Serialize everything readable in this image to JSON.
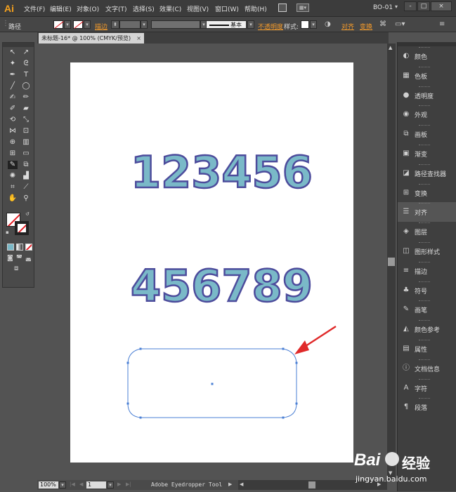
{
  "app": {
    "logo": "Ai",
    "workspace": "BO-01"
  },
  "menu": [
    "文件(F)",
    "编辑(E)",
    "对象(O)",
    "文字(T)",
    "选择(S)",
    "效果(C)",
    "视图(V)",
    "窗口(W)",
    "帮助(H)"
  ],
  "window_buttons": [
    "-",
    "□",
    "×"
  ],
  "control_bar": {
    "label": "路径",
    "stroke_label": "描边",
    "stroke_profile": "基本",
    "opacity_label": "不透明度",
    "style_label": "样式:",
    "align_label": "对齐",
    "transform_label": "变换"
  },
  "document_tab": {
    "title": "未标题-16* @ 100% (CMYK/预览)",
    "close": "×"
  },
  "artboard": {
    "line1": "123456",
    "line2": "456789"
  },
  "colors": {
    "fill": "#7ab9c8",
    "stroke": "#4d4c9c",
    "selection": "#4a7fd4",
    "arrow": "#e02a2a"
  },
  "status": {
    "zoom": "100%",
    "page": "1",
    "tool": "Adobe Eyedropper Tool"
  },
  "panels": [
    {
      "icon": "palette-icon",
      "glyph": "◐",
      "label": "颜色"
    },
    {
      "icon": "swatches-icon",
      "glyph": "▦",
      "label": "色板"
    },
    {
      "icon": "transparency-icon",
      "glyph": "●",
      "label": "透明度"
    },
    {
      "icon": "appearance-icon",
      "glyph": "◉",
      "label": "外观"
    },
    {
      "icon": "artboards-icon",
      "glyph": "⧉",
      "label": "画板"
    },
    {
      "icon": "gradient-icon",
      "glyph": "▣",
      "label": "渐变"
    },
    {
      "icon": "pathfinder-icon",
      "glyph": "◪",
      "label": "路径查找器"
    },
    {
      "icon": "transform-icon",
      "glyph": "⊞",
      "label": "变换"
    },
    {
      "icon": "align-icon",
      "glyph": "☰",
      "label": "对齐"
    },
    {
      "icon": "layers-icon",
      "glyph": "◈",
      "label": "图层"
    },
    {
      "icon": "graphic-styles-icon",
      "glyph": "◫",
      "label": "图形样式"
    },
    {
      "icon": "stroke-icon",
      "glyph": "≡",
      "label": "描边"
    },
    {
      "icon": "symbols-icon",
      "glyph": "♣",
      "label": "符号"
    },
    {
      "icon": "brushes-icon",
      "glyph": "✎",
      "label": "画笔"
    },
    {
      "icon": "color-guide-icon",
      "glyph": "◭",
      "label": "颜色参考"
    },
    {
      "icon": "attributes-icon",
      "glyph": "▤",
      "label": "属性"
    },
    {
      "icon": "document-info-icon",
      "glyph": "ⓘ",
      "label": "文档信息"
    },
    {
      "icon": "character-icon",
      "glyph": "A",
      "label": "字符"
    },
    {
      "icon": "paragraph-icon",
      "glyph": "¶",
      "label": "段落"
    }
  ],
  "watermark": {
    "brand": "Bai",
    "brand2": "经验",
    "url": "jingyan.baidu.com"
  }
}
